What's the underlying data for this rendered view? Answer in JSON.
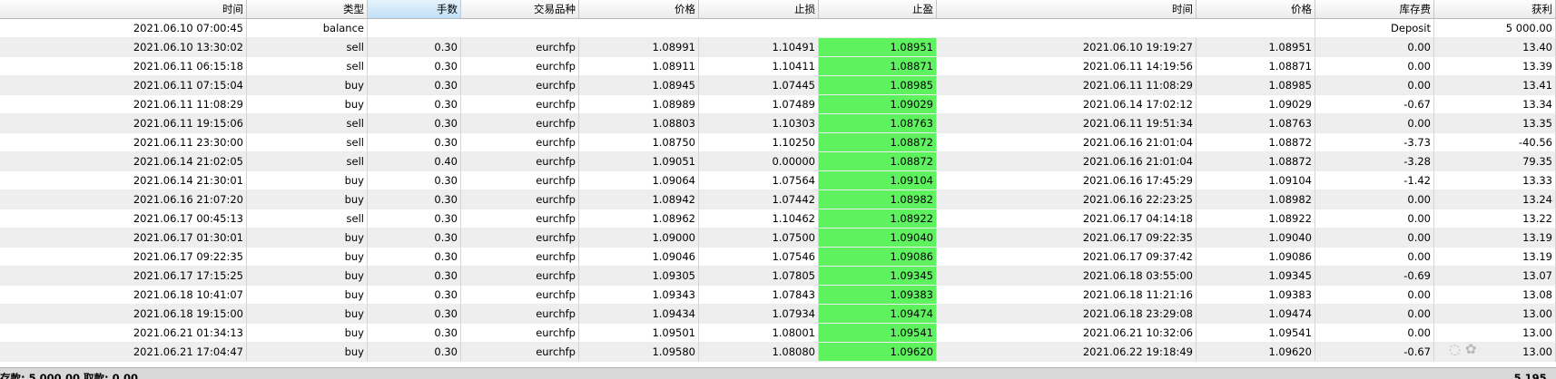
{
  "columns": [
    "时间",
    "类型",
    "手数",
    "交易品种",
    "价格",
    "止损",
    "止盈",
    "时间",
    "价格",
    "库存费",
    "获利"
  ],
  "sorted_column": 2,
  "colors": {
    "take_profit_bg": "#5ff25f",
    "alt_row_bg": "#eeeeee",
    "sorted_header_bg": "#bfe0f7"
  },
  "balance_row": {
    "time": "2021.06.10 07:00:45",
    "type": "balance",
    "comment": "Deposit",
    "profit": "5 000.00"
  },
  "rows": [
    [
      "2021.06.10 13:30:02",
      "sell",
      "0.30",
      "eurchfp",
      "1.08991",
      "1.10491",
      "1.08951",
      "2021.06.10 19:19:27",
      "1.08951",
      "0.00",
      "13.40"
    ],
    [
      "2021.06.11 06:15:18",
      "sell",
      "0.30",
      "eurchfp",
      "1.08911",
      "1.10411",
      "1.08871",
      "2021.06.11 14:19:56",
      "1.08871",
      "0.00",
      "13.39"
    ],
    [
      "2021.06.11 07:15:04",
      "buy",
      "0.30",
      "eurchfp",
      "1.08945",
      "1.07445",
      "1.08985",
      "2021.06.11 11:08:29",
      "1.08985",
      "0.00",
      "13.41"
    ],
    [
      "2021.06.11 11:08:29",
      "buy",
      "0.30",
      "eurchfp",
      "1.08989",
      "1.07489",
      "1.09029",
      "2021.06.14 17:02:12",
      "1.09029",
      "-0.67",
      "13.34"
    ],
    [
      "2021.06.11 19:15:06",
      "sell",
      "0.30",
      "eurchfp",
      "1.08803",
      "1.10303",
      "1.08763",
      "2021.06.11 19:51:34",
      "1.08763",
      "0.00",
      "13.35"
    ],
    [
      "2021.06.11 23:30:00",
      "sell",
      "0.30",
      "eurchfp",
      "1.08750",
      "1.10250",
      "1.08872",
      "2021.06.16 21:01:04",
      "1.08872",
      "-3.73",
      "-40.56"
    ],
    [
      "2021.06.14 21:02:05",
      "sell",
      "0.40",
      "eurchfp",
      "1.09051",
      "0.00000",
      "1.08872",
      "2021.06.16 21:01:04",
      "1.08872",
      "-3.28",
      "79.35"
    ],
    [
      "2021.06.14 21:30:01",
      "buy",
      "0.30",
      "eurchfp",
      "1.09064",
      "1.07564",
      "1.09104",
      "2021.06.16 17:45:29",
      "1.09104",
      "-1.42",
      "13.33"
    ],
    [
      "2021.06.16 21:07:20",
      "buy",
      "0.30",
      "eurchfp",
      "1.08942",
      "1.07442",
      "1.08982",
      "2021.06.16 22:23:25",
      "1.08982",
      "0.00",
      "13.24"
    ],
    [
      "2021.06.17 00:45:13",
      "sell",
      "0.30",
      "eurchfp",
      "1.08962",
      "1.10462",
      "1.08922",
      "2021.06.17 04:14:18",
      "1.08922",
      "0.00",
      "13.22"
    ],
    [
      "2021.06.17 01:30:01",
      "buy",
      "0.30",
      "eurchfp",
      "1.09000",
      "1.07500",
      "1.09040",
      "2021.06.17 09:22:35",
      "1.09040",
      "0.00",
      "13.19"
    ],
    [
      "2021.06.17 09:22:35",
      "buy",
      "0.30",
      "eurchfp",
      "1.09046",
      "1.07546",
      "1.09086",
      "2021.06.17 09:37:42",
      "1.09086",
      "0.00",
      "13.19"
    ],
    [
      "2021.06.17 17:15:25",
      "buy",
      "0.30",
      "eurchfp",
      "1.09305",
      "1.07805",
      "1.09345",
      "2021.06.18 03:55:00",
      "1.09345",
      "-0.69",
      "13.07"
    ],
    [
      "2021.06.18 10:41:07",
      "buy",
      "0.30",
      "eurchfp",
      "1.09343",
      "1.07843",
      "1.09383",
      "2021.06.18 11:21:16",
      "1.09383",
      "0.00",
      "13.08"
    ],
    [
      "2021.06.18 19:15:00",
      "buy",
      "0.30",
      "eurchfp",
      "1.09434",
      "1.07934",
      "1.09474",
      "2021.06.18 23:29:08",
      "1.09474",
      "0.00",
      "13.00"
    ],
    [
      "2021.06.21 01:34:13",
      "buy",
      "0.30",
      "eurchfp",
      "1.09501",
      "1.08001",
      "1.09541",
      "2021.06.21 10:32:06",
      "1.09541",
      "0.00",
      "13.00"
    ],
    [
      "2021.06.21 17:04:47",
      "buy",
      "0.30",
      "eurchfp",
      "1.09580",
      "1.08080",
      "1.09620",
      "2021.06.22 19:18:49",
      "1.09620",
      "-0.67",
      "13.00"
    ]
  ],
  "footer": {
    "summary": "存款: 5 000.00  取款: 0.00",
    "total": "5 195."
  }
}
